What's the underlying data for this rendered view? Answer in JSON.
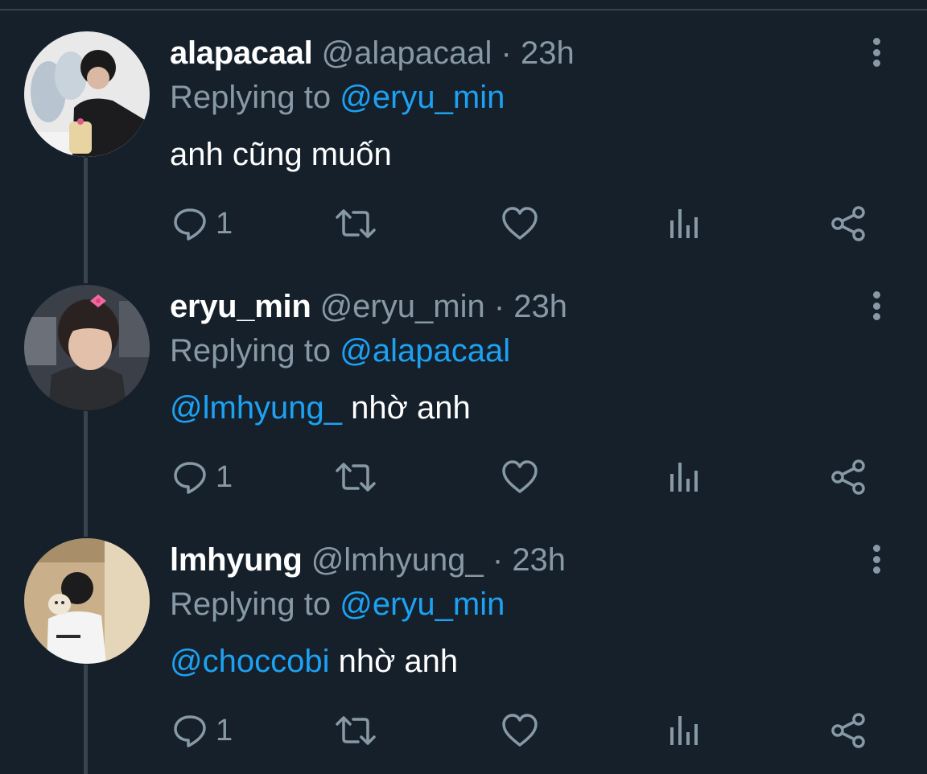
{
  "tweets": [
    {
      "name": "alapacaal",
      "handle": "@alapacaal",
      "separator": "·",
      "time": "23h",
      "replying_prefix": "Replying to ",
      "replying_to": "@eryu_min",
      "text_mention": "",
      "text": "anh cũng muốn",
      "reply_count": "1"
    },
    {
      "name": "eryu_min",
      "handle": "@eryu_min",
      "separator": "·",
      "time": "23h",
      "replying_prefix": "Replying to ",
      "replying_to": "@alapacaal",
      "text_mention": "@lmhyung_",
      "text": " nhờ anh",
      "reply_count": "1"
    },
    {
      "name": "lmhyung",
      "handle": "@lmhyung_",
      "separator": "·",
      "time": "23h",
      "replying_prefix": "Replying to ",
      "replying_to": "@eryu_min",
      "text_mention": "@choccobi",
      "text": " nhờ anh",
      "reply_count": "1"
    }
  ],
  "icons": {
    "reply": "reply-icon",
    "retweet": "retweet-icon",
    "like": "heart-icon",
    "analytics": "analytics-icon",
    "share": "share-icon",
    "more": "more-vertical-icon"
  },
  "colors": {
    "background": "#15202b",
    "text": "#ffffff",
    "muted": "#8899a6",
    "link": "#1da1f2",
    "divider": "#38444d"
  }
}
